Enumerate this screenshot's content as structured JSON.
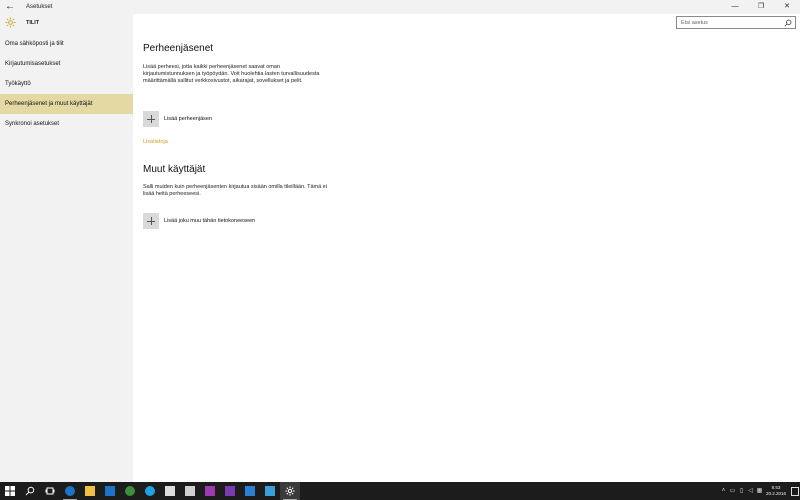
{
  "window": {
    "title": "Asetukset",
    "back_glyph": "←",
    "minimize_glyph": "—",
    "maximize_glyph": "❐",
    "close_glyph": "✕"
  },
  "sidebar": {
    "header_title": "TILIT",
    "items": [
      {
        "label": "Oma sähköposti ja tilit"
      },
      {
        "label": "Kirjautumisasetukset"
      },
      {
        "label": "Työkäyttö"
      },
      {
        "label": "Perheenjäsenet ja muut käyttäjät"
      },
      {
        "label": "Synkronoi asetukset"
      }
    ],
    "active_index": 3
  },
  "search": {
    "placeholder": "Etsi asetus"
  },
  "family": {
    "heading": "Perheenjäsenet",
    "description": "Lisää perheesi, jotta kaikki perheenjäsenet saavat oman kirjautumistunnuksen ja työpöydän. Voit huolehtia lasten turvallisuudesta määrittämällä sallitut verkkosivustot, aikarajat, sovellukset ja pelit.",
    "add_label": "Lisää perheenjäsen",
    "more_link": "Lisätietoja"
  },
  "others": {
    "heading": "Muut käyttäjät",
    "description": "Salli muiden kuin perheenjäsenten kirjautua sisään omilla tileillään. Tämä ei lisää heitä perheeseesi.",
    "add_label": "Lisää joku muu tähän tietokoneeseen"
  },
  "taskbar": {
    "time": "8.53",
    "date": "20.2.2016"
  },
  "colors": {
    "accent": "#c9a227",
    "active_nav": "#e5d9a3",
    "sidebar_bg": "#f2f2f2",
    "taskbar_bg": "#1c1c1c"
  }
}
